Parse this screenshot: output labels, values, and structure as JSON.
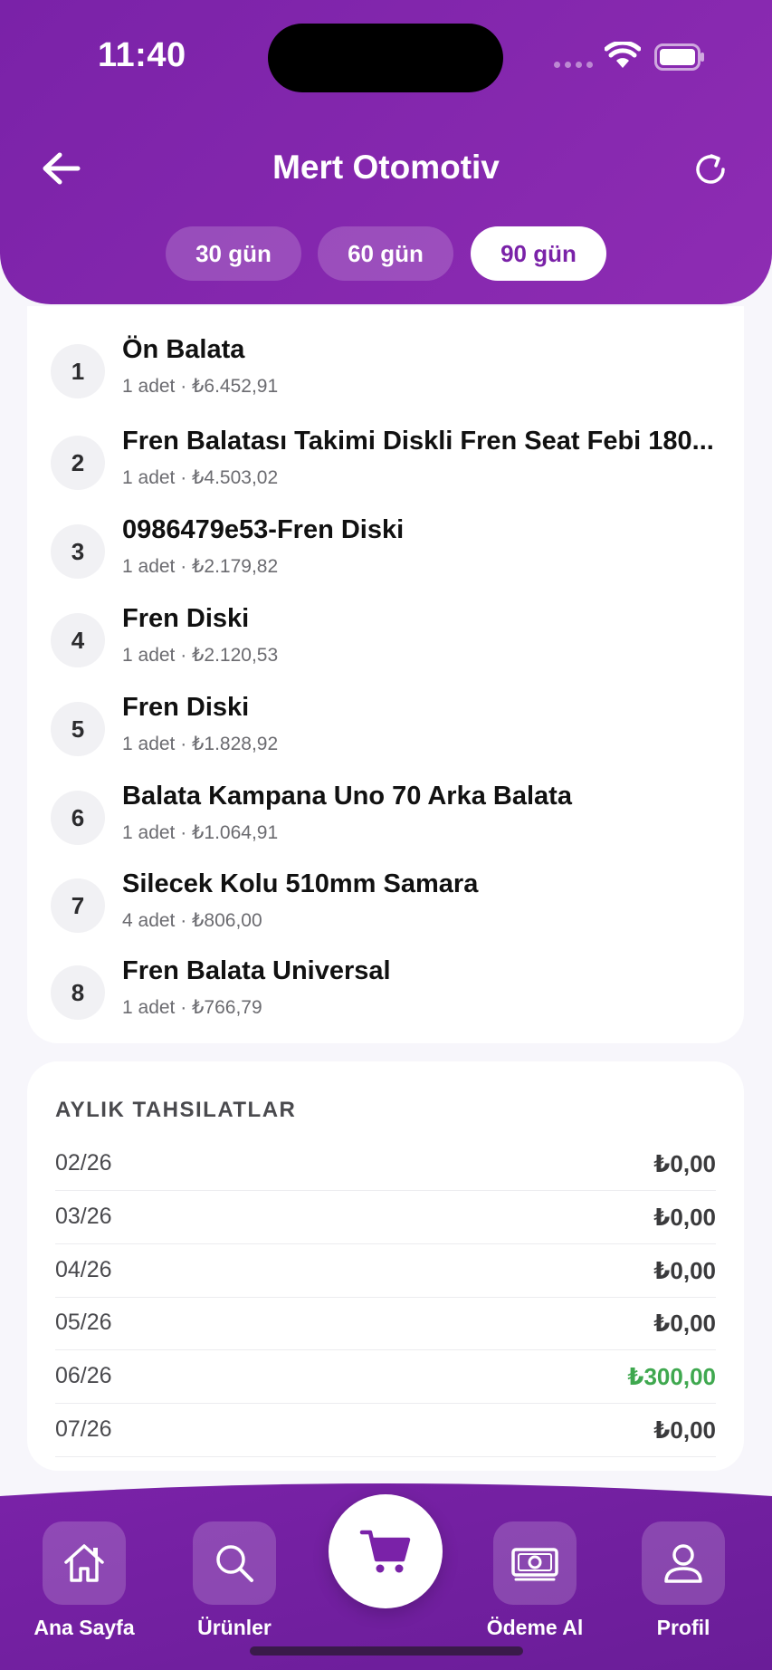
{
  "status_bar": {
    "time": "11:40"
  },
  "header": {
    "title": "Mert Otomotiv",
    "segments": [
      {
        "label": "30 gün",
        "active": false
      },
      {
        "label": "60 gün",
        "active": false
      },
      {
        "label": "90 gün",
        "active": true
      }
    ]
  },
  "products": [
    {
      "rank": "1",
      "name": "Ön Balata",
      "meta": "1 adet · ₺6.452,91"
    },
    {
      "rank": "2",
      "name": "Fren Balatası Takimi Diskli Fren Seat Febi 180...",
      "meta": "1 adet · ₺4.503,02"
    },
    {
      "rank": "3",
      "name": "0986479e53-Fren Diski",
      "meta": "1 adet · ₺2.179,82"
    },
    {
      "rank": "4",
      "name": "Fren Diski",
      "meta": "1 adet · ₺2.120,53"
    },
    {
      "rank": "5",
      "name": "Fren Diski",
      "meta": "1 adet · ₺1.828,92"
    },
    {
      "rank": "6",
      "name": "Balata Kampana Uno 70 Arka Balata",
      "meta": "1 adet · ₺1.064,91"
    },
    {
      "rank": "7",
      "name": "Silecek Kolu 510mm Samara",
      "meta": "4 adet · ₺806,00"
    },
    {
      "rank": "8",
      "name": "Fren Balata Universal",
      "meta": "1 adet · ₺766,79"
    }
  ],
  "collections": {
    "title": "AYLIK TAHSILATLAR",
    "rows": [
      {
        "month": "02/26",
        "amount": "₺0,00",
        "positive": false
      },
      {
        "month": "03/26",
        "amount": "₺0,00",
        "positive": false
      },
      {
        "month": "04/26",
        "amount": "₺0,00",
        "positive": false
      },
      {
        "month": "05/26",
        "amount": "₺0,00",
        "positive": false
      },
      {
        "month": "06/26",
        "amount": "₺300,00",
        "positive": true
      },
      {
        "month": "07/26",
        "amount": "₺0,00",
        "positive": false
      }
    ]
  },
  "bottom_nav": {
    "items": [
      {
        "label": "Ana Sayfa",
        "icon": "home-icon"
      },
      {
        "label": "Ürünler",
        "icon": "search-icon"
      },
      {
        "label": "",
        "icon": "cart-icon"
      },
      {
        "label": "Ödeme Al",
        "icon": "cash-icon"
      },
      {
        "label": "Profil",
        "icon": "user-icon"
      }
    ]
  },
  "colors": {
    "brand_purple": "#7a22a8",
    "positive_green": "#3fa84f"
  }
}
